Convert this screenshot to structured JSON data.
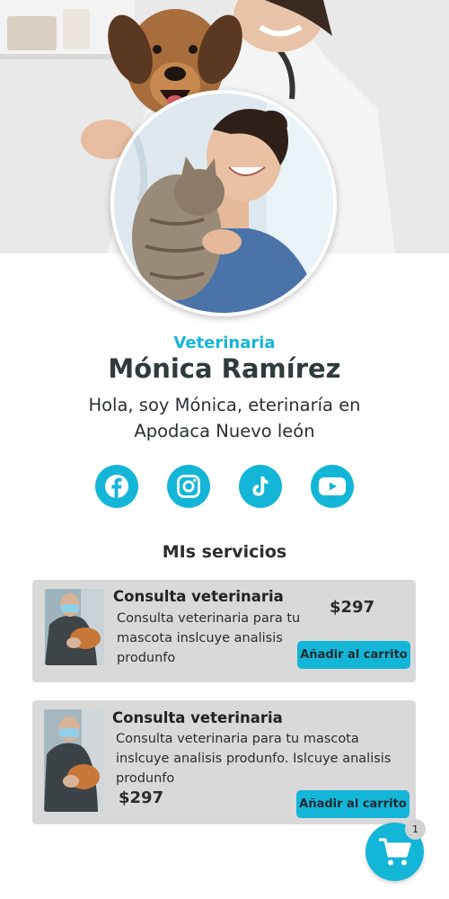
{
  "profile": {
    "role": "Veterinaria",
    "name": "Mónica Ramírez",
    "bio": "Hola, soy Mónica, eterinaría en Apodaca Nuevo león"
  },
  "social": {
    "items": [
      {
        "icon": "facebook-icon"
      },
      {
        "icon": "instagram-icon"
      },
      {
        "icon": "tiktok-icon"
      },
      {
        "icon": "youtube-icon"
      }
    ]
  },
  "services": {
    "title": "MIs servicios",
    "items": [
      {
        "title": "Consulta veterinaria",
        "description": "Consulta veterinaria para tu mascota inslcuye analisis produnfo",
        "price": "$297",
        "button": "Añadir al carrito"
      },
      {
        "title": "Consulta veterinaria",
        "description": "Consulta veterinaria para tu mascota inslcuye analisis produnfo. Islcuye analisis produnfo",
        "price": "$297",
        "button": "Añadir al carrito"
      }
    ]
  },
  "cart": {
    "icon": "shopping-cart-icon",
    "count": "1"
  },
  "colors": {
    "accent": "#14b6d8",
    "card_background": "#d9d9d9",
    "text_dark": "#2f3a3c"
  }
}
